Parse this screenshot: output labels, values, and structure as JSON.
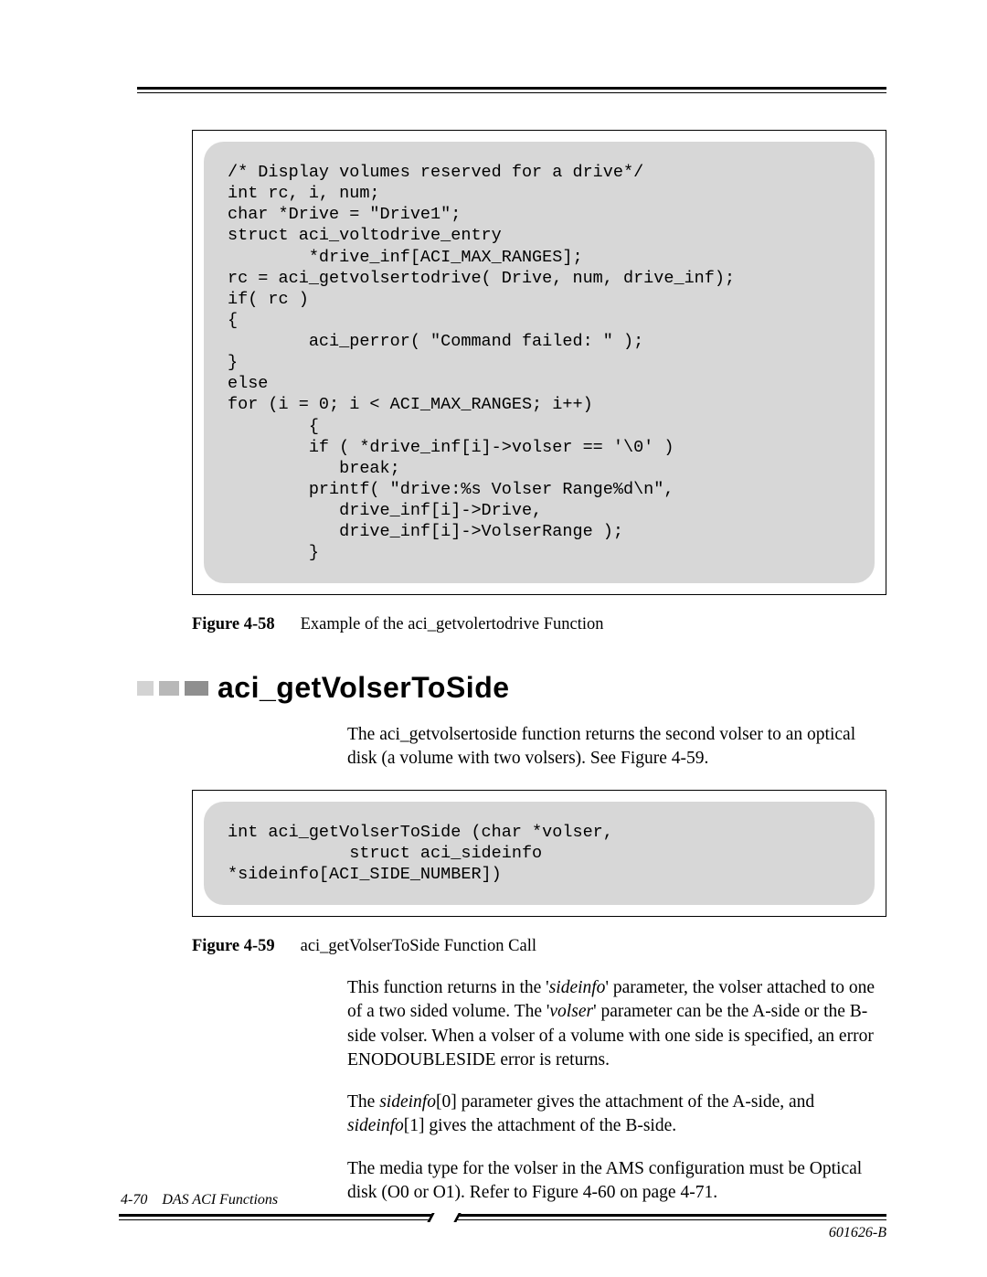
{
  "code1": "/* Display volumes reserved for a drive*/\nint rc, i, num;\nchar *Drive = \"Drive1\";\nstruct aci_voltodrive_entry\n        *drive_inf[ACI_MAX_RANGES];\nrc = aci_getvolsertodrive( Drive, num, drive_inf);\nif( rc )\n{\n        aci_perror( \"Command failed: \" );\n}\nelse\nfor (i = 0; i < ACI_MAX_RANGES; i++)\n        {\n        if ( *drive_inf[i]->volser == '\\0' )\n           break;\n        printf( \"drive:%s Volser Range%d\\n\",\n           drive_inf[i]->Drive,\n           drive_inf[i]->VolserRange );\n        }",
  "caption1": {
    "label": "Figure 4-58",
    "text": "Example of the aci_getvolertodrive Function"
  },
  "section_title": "aci_getVolserToSide",
  "para1_a": "The aci_getvolsertoside function returns the second volser to an optical disk (a volume with two volsers). See ",
  "para1_b": "Figure 4-59",
  "para1_c": ".",
  "code2": "int aci_getVolserToSide (char *volser,\n            struct aci_sideinfo\n*sideinfo[ACI_SIDE_NUMBER])",
  "caption2": {
    "label": "Figure 4-59",
    "text": "aci_getVolserToSide Function Call"
  },
  "para2_a": "This function returns in the '",
  "para2_b": "sideinfo",
  "para2_c": "' parameter, the volser attached to one of a two sided volume. The '",
  "para2_d": "volser",
  "para2_e": "' parameter can be the A-side or the B-side volser. When a volser of a volume with one side is specified, an error ENODOUBLESIDE error is returns.",
  "para3_a": "The ",
  "para3_b": "sideinfo",
  "para3_c": "[0] parameter gives the attachment of the A-side, and ",
  "para3_d": "sideinfo",
  "para3_e": "[1] gives the attachment of the B-side.",
  "para4_a": "The media type for the volser in the AMS configuration must be Optical disk (O0 or O1). Refer to ",
  "para4_b": "Figure 4-60 on page 4-71",
  "para4_c": ".",
  "footer": {
    "page": "4-70",
    "chapter": "DAS ACI Functions",
    "docid": "601626-B"
  }
}
